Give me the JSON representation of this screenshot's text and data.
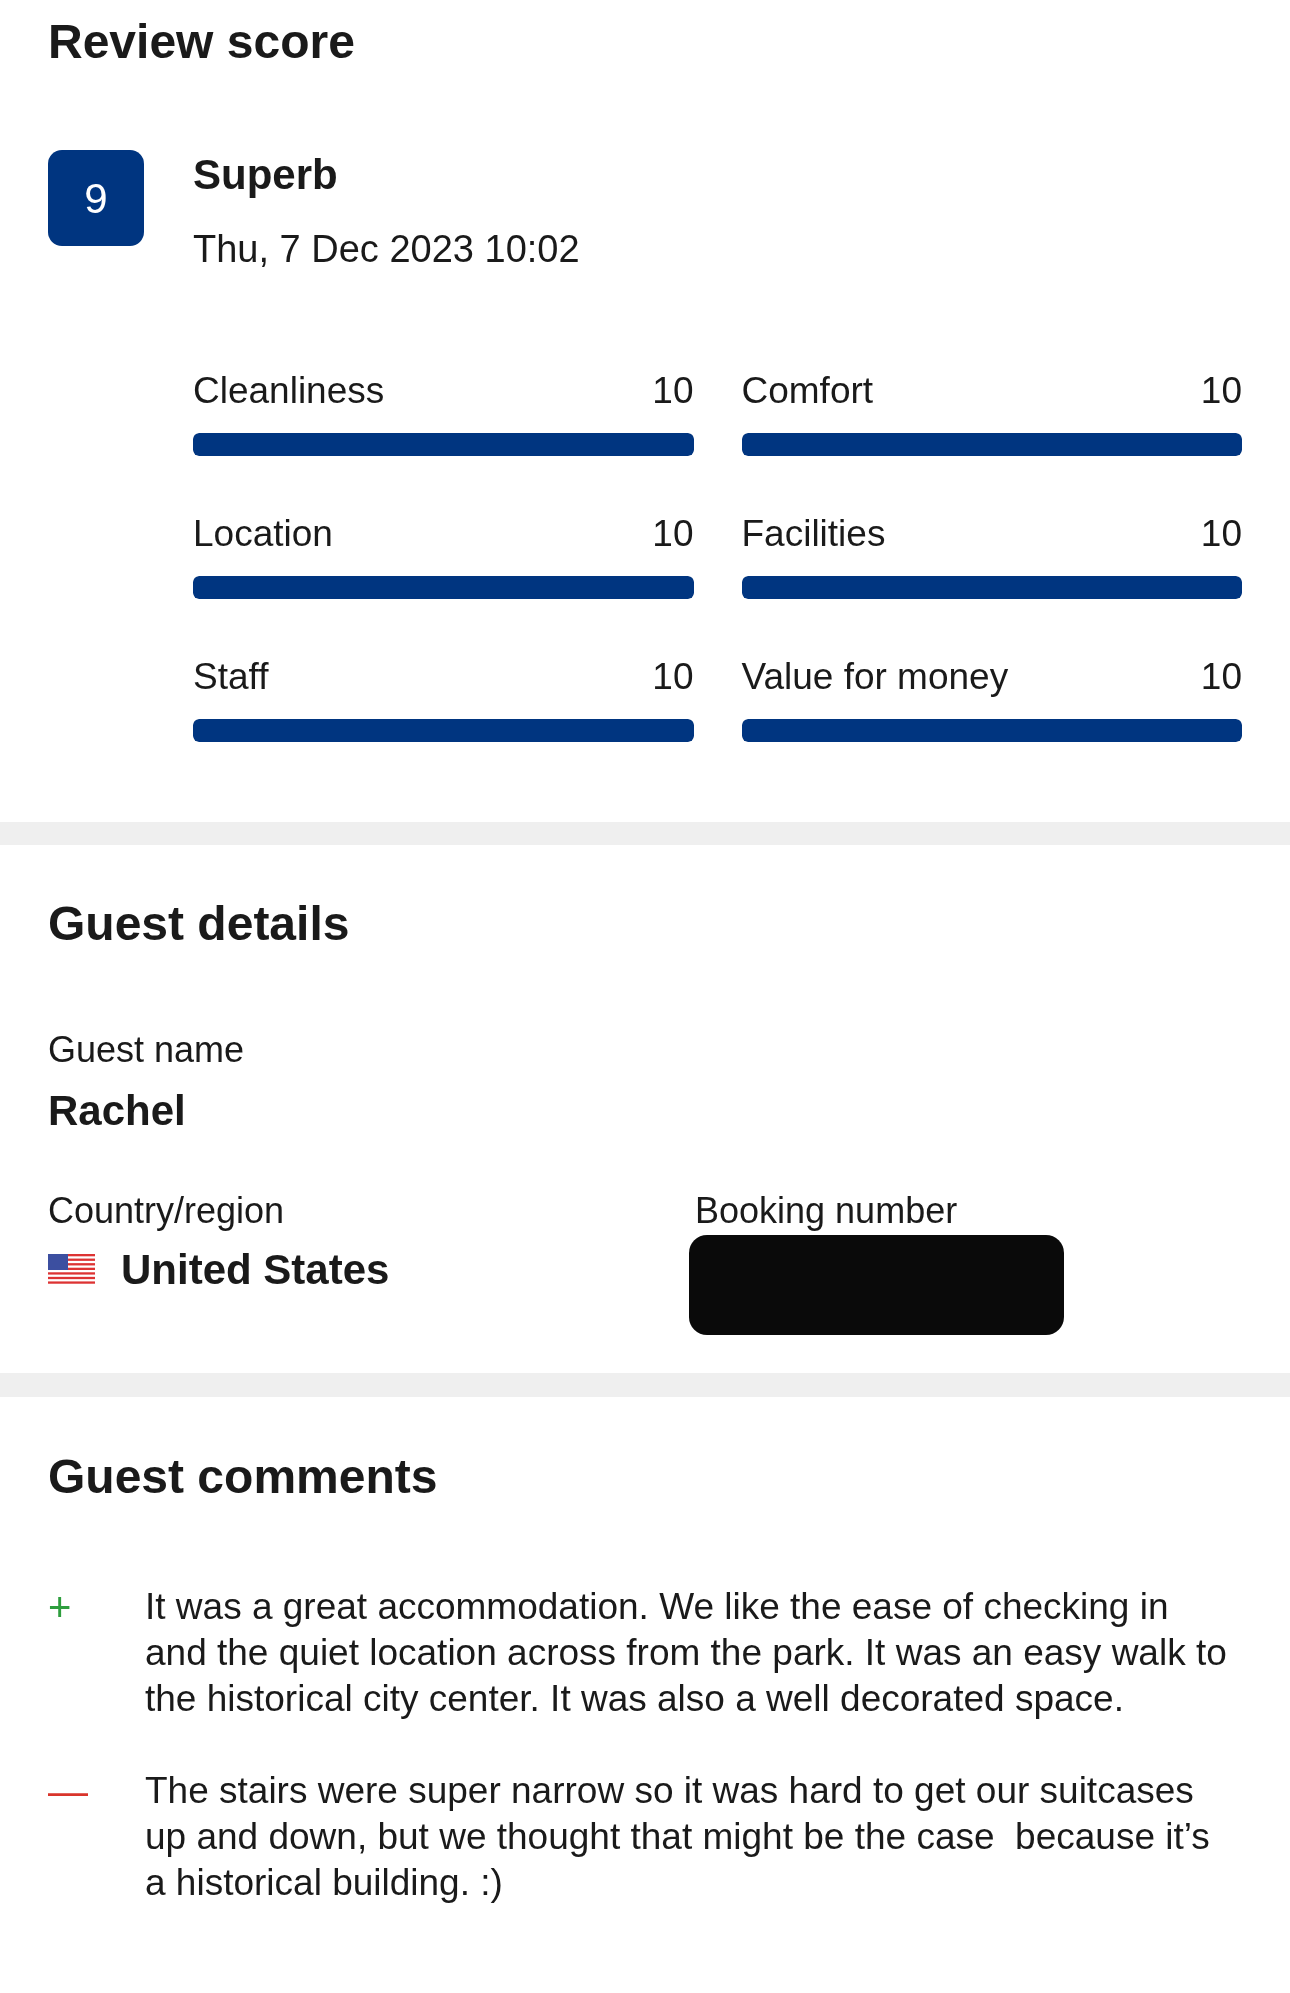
{
  "review_score": {
    "title": "Review score",
    "score": "9",
    "verdict": "Superb",
    "date": "Thu, 7 Dec 2023 10:02",
    "ratings": [
      {
        "label": "Cleanliness",
        "value": "10",
        "level": 1
      },
      {
        "label": "Comfort",
        "value": "10",
        "level": 1
      },
      {
        "label": "Location",
        "value": "10",
        "level": 1
      },
      {
        "label": "Facilities",
        "value": "10",
        "level": 1
      },
      {
        "label": "Staff",
        "value": "10",
        "level": 1
      },
      {
        "label": "Value for money",
        "value": "10",
        "level": 1
      }
    ]
  },
  "guest_details": {
    "title": "Guest details",
    "name_label": "Guest name",
    "name": "Rachel",
    "country_label": "Country/region",
    "country": "United States",
    "booking_label": "Booking number"
  },
  "guest_comments": {
    "title": "Guest comments",
    "comments": [
      {
        "kind": "positive",
        "sign": "+",
        "text": "It was a great accommodation. We like the ease of checking in and the quiet location across from the park. It was an easy walk to the historical city center. It was also a well decorated space."
      },
      {
        "kind": "negative",
        "sign": "—",
        "text": "The stairs were super narrow so it was hard to get our suitcases up and down, but we thought that might be the case  because it’s a historical building. :)"
      }
    ]
  }
}
